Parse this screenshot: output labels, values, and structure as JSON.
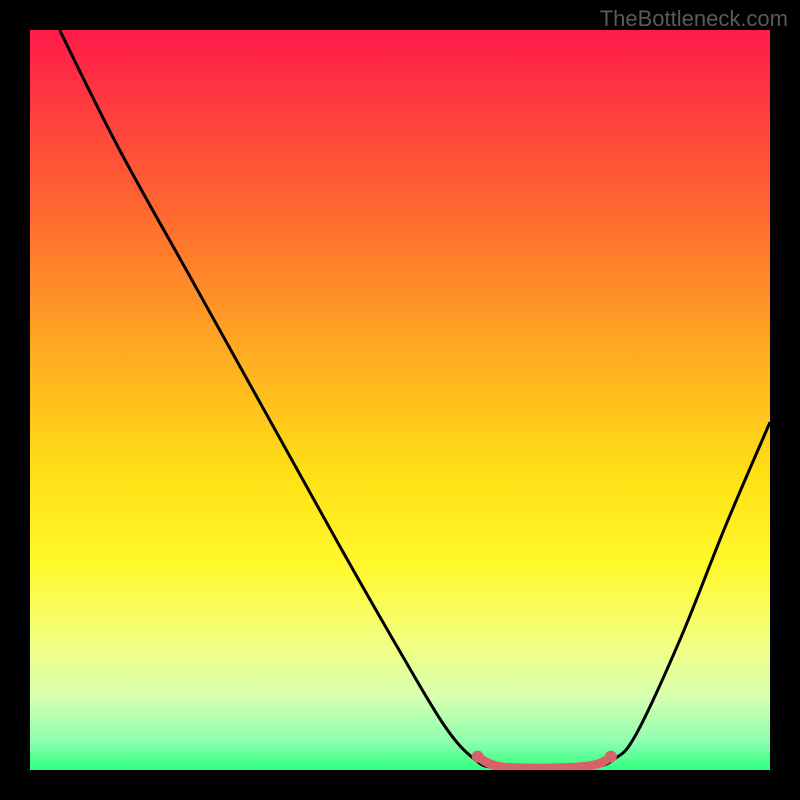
{
  "watermark": "TheBottleneck.com",
  "chart_data": {
    "type": "line",
    "title": "",
    "xlabel": "",
    "ylabel": "",
    "xlim": [
      0,
      100
    ],
    "ylim": [
      0,
      100
    ],
    "background_gradient": {
      "stops": [
        {
          "offset": 0.0,
          "color": "#ff1a4a"
        },
        {
          "offset": 0.1,
          "color": "#ff3a3f"
        },
        {
          "offset": 0.25,
          "color": "#ff6a30"
        },
        {
          "offset": 0.45,
          "color": "#ffb020"
        },
        {
          "offset": 0.6,
          "color": "#ffe015"
        },
        {
          "offset": 0.72,
          "color": "#fff82a"
        },
        {
          "offset": 0.82,
          "color": "#f4ff7a"
        },
        {
          "offset": 0.9,
          "color": "#d8ffb0"
        },
        {
          "offset": 0.96,
          "color": "#90ffb0"
        },
        {
          "offset": 1.0,
          "color": "#2fff80"
        }
      ]
    },
    "series": [
      {
        "name": "bottleneck-curve",
        "color": "#000000",
        "points": [
          {
            "x": 4,
            "y": 100
          },
          {
            "x": 12,
            "y": 84
          },
          {
            "x": 22,
            "y": 66
          },
          {
            "x": 32,
            "y": 48
          },
          {
            "x": 42,
            "y": 30
          },
          {
            "x": 50,
            "y": 16
          },
          {
            "x": 56,
            "y": 6
          },
          {
            "x": 60,
            "y": 1.5
          },
          {
            "x": 63,
            "y": 0.3
          },
          {
            "x": 70,
            "y": 0.2
          },
          {
            "x": 76,
            "y": 0.4
          },
          {
            "x": 79,
            "y": 1.5
          },
          {
            "x": 82,
            "y": 5
          },
          {
            "x": 88,
            "y": 18
          },
          {
            "x": 94,
            "y": 33
          },
          {
            "x": 100,
            "y": 47
          }
        ]
      },
      {
        "name": "optimal-band",
        "color": "#d9616a",
        "points": [
          {
            "x": 60.5,
            "y": 1.8
          },
          {
            "x": 62,
            "y": 0.9
          },
          {
            "x": 64,
            "y": 0.4
          },
          {
            "x": 68,
            "y": 0.25
          },
          {
            "x": 72,
            "y": 0.3
          },
          {
            "x": 75,
            "y": 0.5
          },
          {
            "x": 77,
            "y": 0.9
          },
          {
            "x": 78.5,
            "y": 1.8
          }
        ],
        "endpoints": [
          {
            "x": 60.5,
            "y": 1.8
          },
          {
            "x": 78.5,
            "y": 1.8
          }
        ]
      }
    ]
  }
}
